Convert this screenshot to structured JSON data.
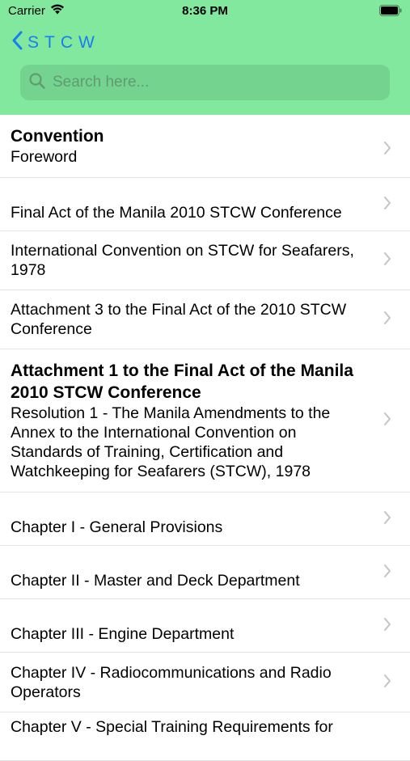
{
  "status_bar": {
    "carrier": "Carrier",
    "time": "8:36 PM",
    "wifi_icon": "wifi-icon",
    "battery_icon": "battery-icon"
  },
  "nav": {
    "back_label": "STCW",
    "back_icon": "chevron-back-icon"
  },
  "search": {
    "placeholder": "Search here...",
    "value": "",
    "icon": "search-icon"
  },
  "colors": {
    "header_bg": "#82e89e",
    "search_bg": "#74d38f",
    "accent": "#1a7cf2"
  },
  "list": {
    "items": [
      {
        "title": "Convention",
        "text": "Foreword"
      },
      {
        "title": "",
        "text": "Final Act of the Manila 2010 STCW Conference"
      },
      {
        "title": "",
        "text": "International Convention on STCW for Seafarers, 1978"
      },
      {
        "title": "",
        "text": "Attachment 3 to the Final Act of the 2010 STCW Conference"
      },
      {
        "title": "Attachment 1 to the Final Act of the Manila 2010 STCW Conference",
        "text": "Resolution 1 - The Manila Amendments to the Annex to the International Convention on Standards of Training, Certification and Watchkeeping for Seafarers (STCW), 1978"
      },
      {
        "title": "",
        "text": "Chapter I - General Provisions"
      },
      {
        "title": "",
        "text": "Chapter II - Master and Deck Department"
      },
      {
        "title": "",
        "text": "Chapter III - Engine Department"
      },
      {
        "title": "",
        "text": "Chapter IV - Radiocommunications and Radio Operators"
      },
      {
        "title": "",
        "text": "Chapter V - Special Training Requirements for"
      }
    ]
  }
}
